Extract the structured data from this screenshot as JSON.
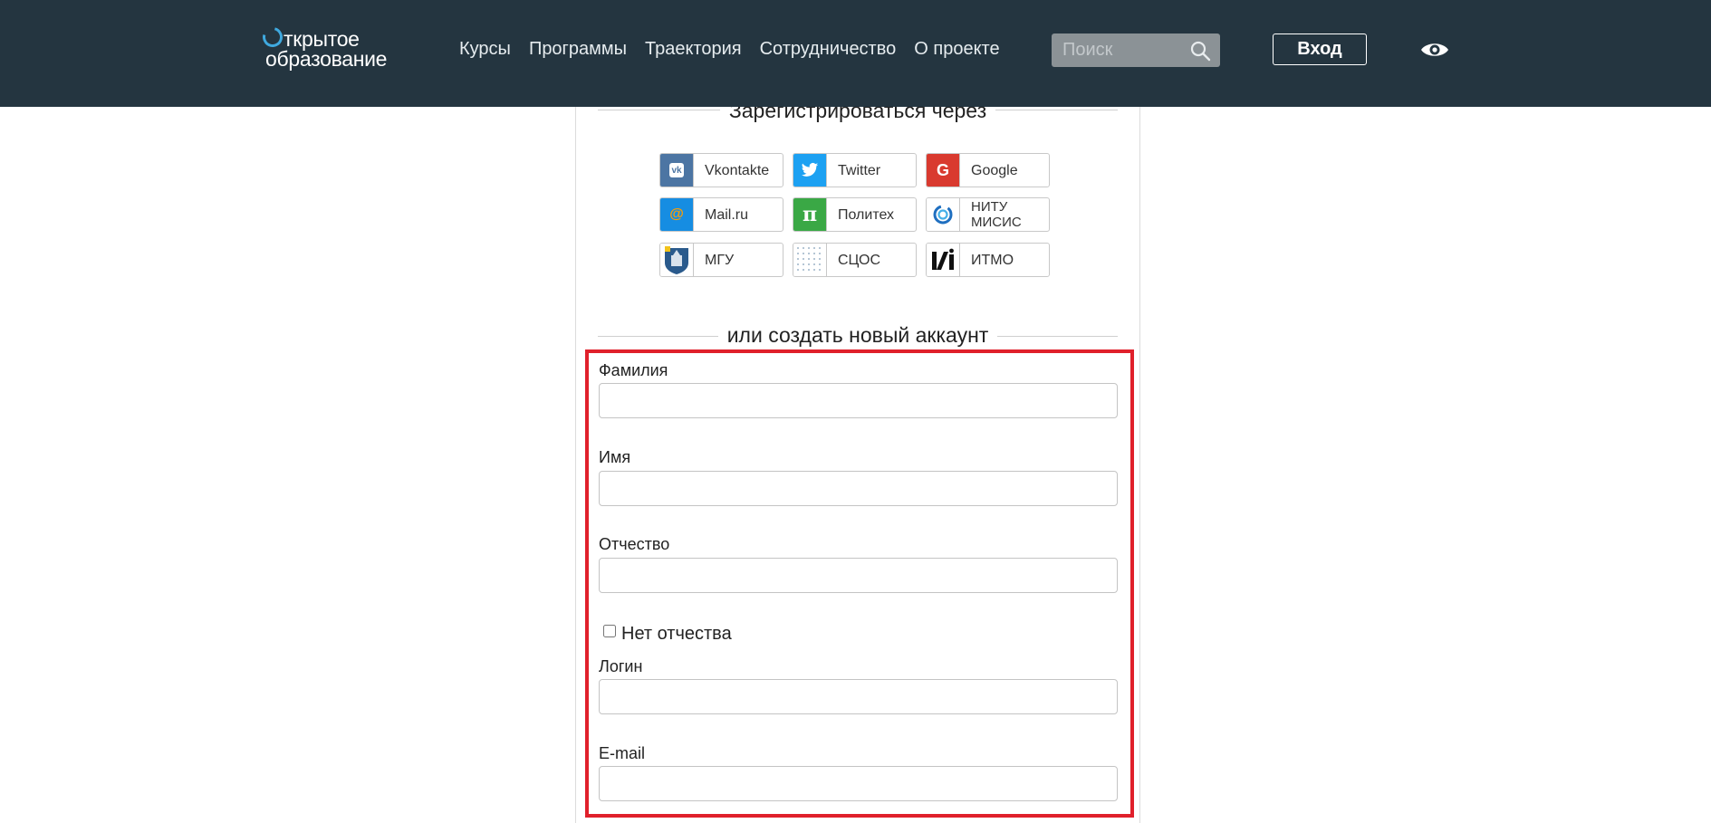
{
  "header": {
    "logo_line1": "ткрытое",
    "logo_line2": "образование",
    "nav": [
      "Курсы",
      "Программы",
      "Траектория",
      "Сотрудничество",
      "О проекте"
    ],
    "search_placeholder": "Поиск",
    "login_label": "Вход"
  },
  "social": {
    "heading": "Зарегистрироваться через",
    "providers": [
      {
        "label": "Vkontakte",
        "icon": "vk-icon",
        "color": "#4c75a3"
      },
      {
        "label": "Twitter",
        "icon": "twitter-icon",
        "color": "#1da1f2"
      },
      {
        "label": "Google",
        "icon": "google-icon",
        "color": "#d93a2f"
      },
      {
        "label": "Mail.ru",
        "icon": "mailru-icon",
        "color": "#168de2"
      },
      {
        "label": "Политех",
        "icon": "polytech-icon",
        "color": "#3aa845"
      },
      {
        "label": "НИТУ МИСИС",
        "icon": "misis-icon",
        "color": "#ffffff"
      },
      {
        "label": "МГУ",
        "icon": "msu-icon",
        "color": "#2a5a8c"
      },
      {
        "label": "СЦОС",
        "icon": "scos-icon",
        "color": "#ffffff"
      },
      {
        "label": "ИТМО",
        "icon": "itmo-icon",
        "color": "#ffffff"
      }
    ]
  },
  "form": {
    "heading": "или создать новый аккаунт",
    "last_name_label": "Фамилия",
    "first_name_label": "Имя",
    "patronymic_label": "Отчество",
    "no_patronymic_label": "Нет отчества",
    "login_label": "Логин",
    "email_label": "E-mail",
    "no_patronymic_checked": false
  },
  "colors": {
    "header_bg": "#243540",
    "highlight": "#e0202b",
    "logo_accent": "#3fa9df"
  }
}
